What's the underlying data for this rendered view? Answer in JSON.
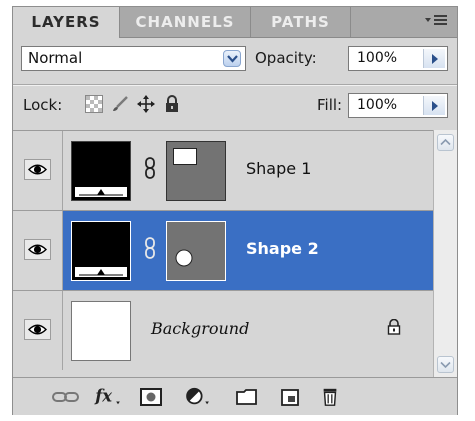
{
  "tabs": [
    {
      "label": "LAYERS",
      "active": true
    },
    {
      "label": "CHANNELS",
      "active": false
    },
    {
      "label": "PATHS",
      "active": false
    }
  ],
  "tab_menu_icon": "panel-menu-icon",
  "blend": {
    "mode": "Normal",
    "opacity_label": "Opacity:",
    "opacity_value": "100%"
  },
  "lock": {
    "label": "Lock:",
    "fill_label": "Fill:",
    "fill_value": "100%"
  },
  "layers": [
    {
      "name": "Shape 1",
      "selected": false,
      "type": "shape",
      "mask_shape": "square"
    },
    {
      "name": "Shape 2",
      "selected": true,
      "type": "shape",
      "mask_shape": "circle"
    },
    {
      "name": "Background",
      "selected": false,
      "type": "background",
      "locked": true
    }
  ],
  "colors": {
    "selection": "#3a6fc4",
    "panel_bg": "#d6d6d6",
    "tab_bar": "#a9a9a9"
  },
  "bottom_icons": [
    "link-layers-icon",
    "fx-layer-style-icon",
    "add-mask-icon",
    "adjustment-layer-icon",
    "new-group-icon",
    "new-layer-icon",
    "delete-layer-icon"
  ]
}
